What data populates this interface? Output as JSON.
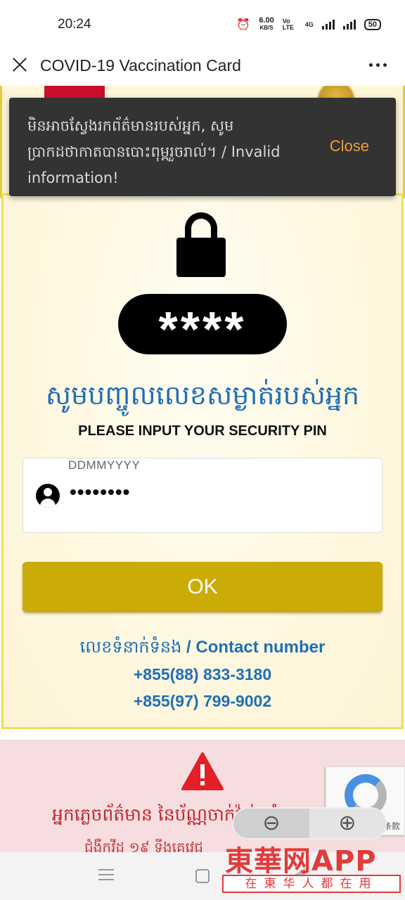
{
  "status_bar": {
    "time": "20:24",
    "speed_value": "6.00",
    "speed_unit": "KB/S",
    "volte": "Vo LTE",
    "network": "4G",
    "battery": "50"
  },
  "app_bar": {
    "title": "COVID-19 Vaccination Card"
  },
  "snackbar": {
    "message": "មិនអាចស្វែងរកព័ត៌មានរបស់អ្នក, សូមប្រាកដថាកាតបានបោះពុម្ពរួចរាល់។ / Invalid information!",
    "close_label": "Close"
  },
  "pin_display": "****",
  "khmer_title": "សូមបញ្ចូលលេខសម្ងាត់របស់អ្នក",
  "english_title": "PLEASE INPUT YOUR SECURITY PIN",
  "pin_field": {
    "hint": "DDMMYYYY",
    "value": "••••••••"
  },
  "ok_label": "OK",
  "contact": {
    "heading_khmer": "លេខទំនាក់ទំនង",
    "heading_english": " / Contact number",
    "phones": [
      "+855(88) 833-3180",
      "+855(97) 799-9002"
    ]
  },
  "alert": {
    "line1": "អ្នកភ្លេចព័ត៌មាន នៃប័ណ្ណចាក់វ៉ាក់សាំង",
    "line2": "ជំងឺកូវីដ ១៩ ទីងគេវេជ្ជ"
  },
  "recaptcha": {
    "terms": "条款"
  },
  "zoom": {
    "minus_symbol": "⊖",
    "plus_symbol": "⊕"
  },
  "watermark": {
    "main": "東華网APP",
    "sub": "在東华人都在用"
  },
  "colors": {
    "accent_blue": "#1f6fb8",
    "ok_gold": "#cbab05",
    "snackbar_bg": "#333333",
    "close_orange": "#e9a23a",
    "alert_red": "#c0282a"
  }
}
